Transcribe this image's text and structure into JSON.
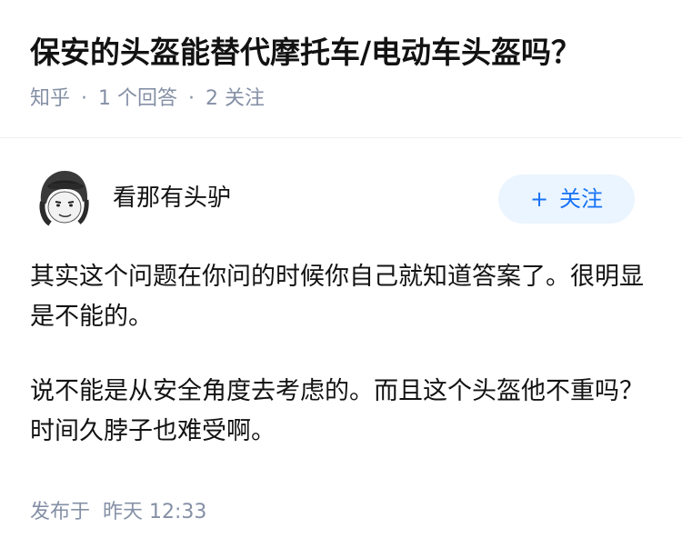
{
  "question": {
    "title": "保安的头盔能替代摩托车/电动车头盔吗？",
    "source": "知乎",
    "answer_count": "1 个回答",
    "follower_count": "2 关注"
  },
  "answer": {
    "author": {
      "name": "看那有头驴",
      "avatar_icon": "helmet-meme-avatar"
    },
    "follow_button": {
      "icon": "plus-icon",
      "label": "关注",
      "color": "#1772f6",
      "background": "#ebf5ff"
    },
    "paragraphs": [
      "其实这个问题在你问的时候你自己就知道答案了。很明显是不能的。",
      "说不能是从安全角度去考虑的。而且这个头盔他不重吗？时间久脖子也难受啊。"
    ],
    "publish": {
      "label": "发布于",
      "time": "昨天 12:33"
    }
  }
}
